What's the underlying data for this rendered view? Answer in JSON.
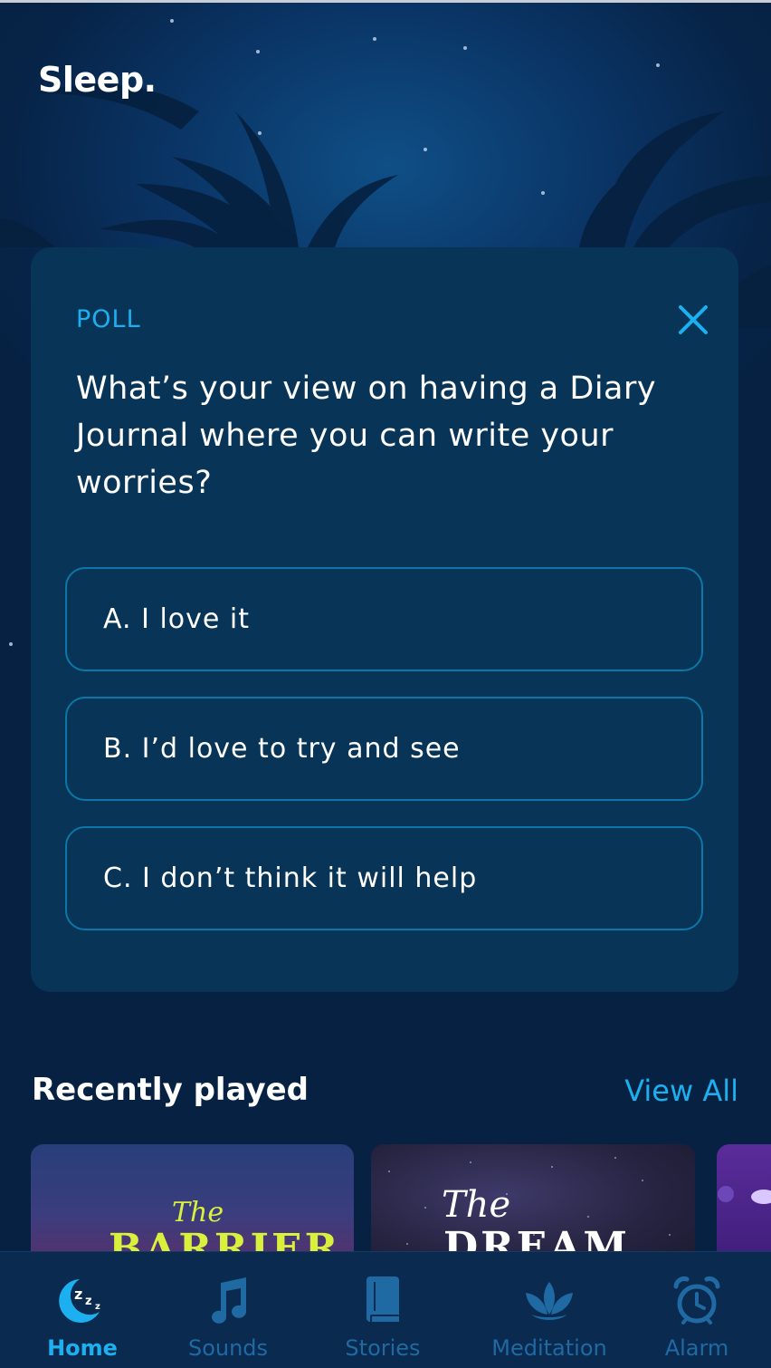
{
  "app": {
    "title": "Sleep."
  },
  "poll": {
    "label": "POLL",
    "question": "What’s your view on having a Diary Journal where you can write your worries?",
    "options": [
      {
        "label": "A. I love it"
      },
      {
        "label": "B. I’d love to try and see"
      },
      {
        "label": "C. I don’t think it will help"
      }
    ]
  },
  "recently_played": {
    "title": "Recently played",
    "view_all": "View All",
    "cards": [
      {
        "script": "The",
        "title": "BARRIER",
        "script_color": "#d9f03c"
      },
      {
        "script": "The",
        "title": "DREAM",
        "script_color": "#ffffff"
      }
    ]
  },
  "nav": {
    "items": [
      {
        "label": "Home",
        "icon": "moon-zzz-icon",
        "active": true
      },
      {
        "label": "Sounds",
        "icon": "music-note-icon",
        "active": false
      },
      {
        "label": "Stories",
        "icon": "book-icon",
        "active": false
      },
      {
        "label": "Meditation",
        "icon": "lotus-icon",
        "active": false
      },
      {
        "label": "Alarm",
        "icon": "alarm-clock-icon",
        "active": false
      }
    ]
  },
  "colors": {
    "accent": "#1cb0f0",
    "background": "#072346",
    "card": "#073457",
    "nav_inactive": "#1f6aa3"
  }
}
